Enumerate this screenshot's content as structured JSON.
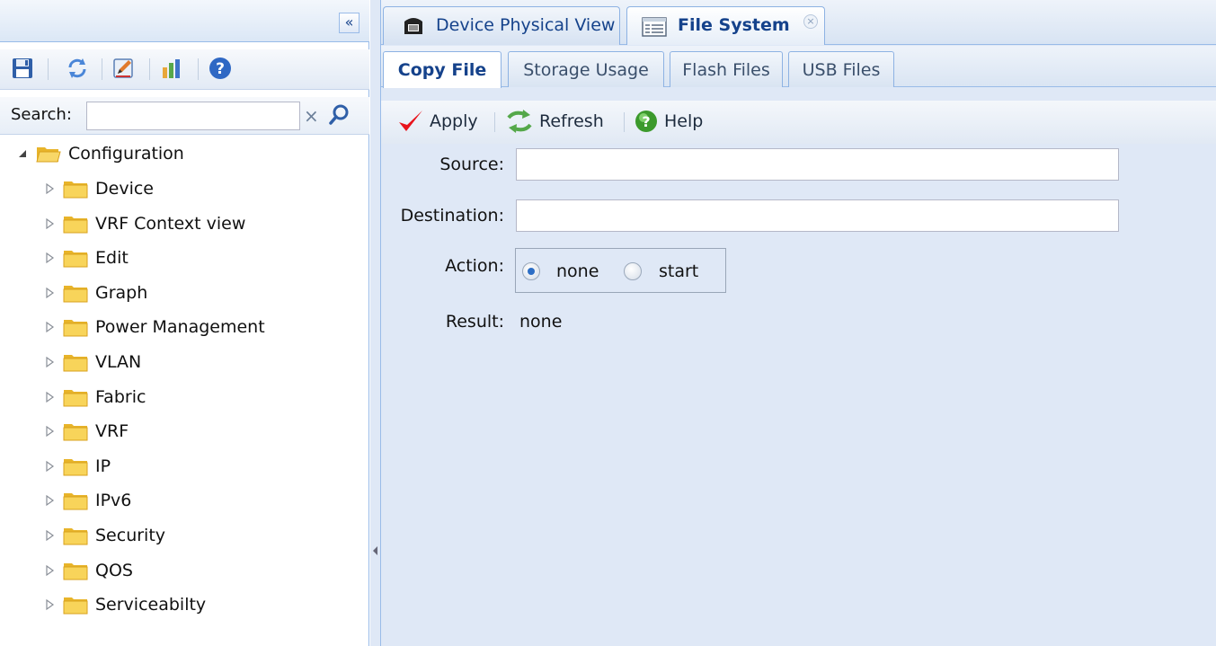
{
  "left_panel": {
    "collapse_glyph": "«",
    "toolbar_icons": [
      "save-icon",
      "refresh-icon",
      "edit-icon",
      "chart-icon",
      "help-icon"
    ],
    "search": {
      "label": "Search:",
      "value": "",
      "clear_glyph": "×"
    },
    "tree": {
      "root": "Configuration",
      "children": [
        "Device",
        "VRF Context view",
        "Edit",
        "Graph",
        "Power Management",
        "VLAN",
        "Fabric",
        "VRF",
        "IP",
        "IPv6",
        "Security",
        "QOS",
        "Serviceabilty"
      ]
    }
  },
  "tabs": [
    {
      "label": "Device Physical View",
      "icon": "device-icon",
      "active": false
    },
    {
      "label": "File System",
      "icon": "file-system-icon",
      "active": true,
      "close_glyph": "×"
    }
  ],
  "subtabs": [
    "Copy File",
    "Storage Usage",
    "Flash Files",
    "USB Files"
  ],
  "actions": [
    {
      "label": "Apply",
      "icon": "check-icon"
    },
    {
      "label": "Refresh",
      "icon": "refresh-icon"
    },
    {
      "label": "Help",
      "icon": "help-icon"
    }
  ],
  "form": {
    "source": {
      "label": "Source:",
      "value": ""
    },
    "destination": {
      "label": "Destination:",
      "value": ""
    },
    "action": {
      "label": "Action:",
      "options": [
        "none",
        "start"
      ],
      "selected": "none"
    },
    "result": {
      "label": "Result:",
      "value": "none"
    }
  },
  "colors": {
    "accent": "#15428b",
    "panel_bg": "#dfe8f6",
    "border": "#99bbe8",
    "folder": "#f5c841",
    "check_red": "#e8141c",
    "help_green": "#3c9a2c"
  }
}
